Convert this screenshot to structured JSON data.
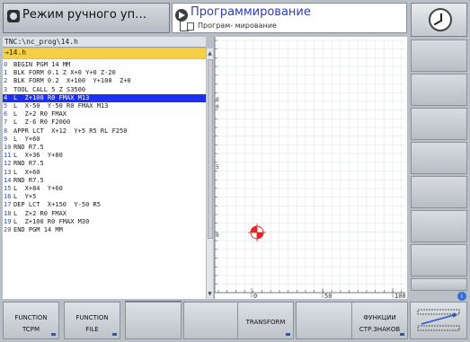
{
  "header": {
    "mode_manual_label": "Режим ручного уп…",
    "mode_program_label": "Программирование",
    "mode_program_sub": "Програм- мирование"
  },
  "editor": {
    "path": "TNC:\\nc_prog\\14.h",
    "file": "→14.h",
    "lines": [
      {
        "num": "0",
        "code": "BEGIN PGM 14 MM"
      },
      {
        "num": "1",
        "code": "BLK FORM 0.1 Z X+0 Y+0 Z-20"
      },
      {
        "num": "2",
        "code": "BLK FORM 0.2  X+100  Y+100  Z+0"
      },
      {
        "num": "3",
        "code": "TOOL CALL 5 Z S3500"
      },
      {
        "num": "4",
        "code": "L  Z+100 R0 FMAX M13",
        "selected": true
      },
      {
        "num": "5",
        "code": "L  X-50  Y-50 R0 FMAX M13"
      },
      {
        "num": "6",
        "code": "L  Z+2 R0 FMAX"
      },
      {
        "num": "7",
        "code": "L  Z-6 R0 F2000"
      },
      {
        "num": "8",
        "code": "APPR LCT  X+12  Y+5 R5 RL F250"
      },
      {
        "num": "9",
        "code": "L  Y+60"
      },
      {
        "num": "10",
        "code": "RND R7.5"
      },
      {
        "num": "11",
        "code": "L  X+36  Y+80"
      },
      {
        "num": "12",
        "code": "RND R7.5"
      },
      {
        "num": "13",
        "code": "L  X+60"
      },
      {
        "num": "14",
        "code": "RND R7.5"
      },
      {
        "num": "15",
        "code": "L  X+84  Y+60"
      },
      {
        "num": "16",
        "code": "L  Y+5"
      },
      {
        "num": "17",
        "code": "DEP LCT  X+150  Y-50 R5"
      },
      {
        "num": "18",
        "code": "L  Z+2 R0 FMAX"
      },
      {
        "num": "19",
        "code": "L  Z+100 R0 FMAX M30"
      },
      {
        "num": "20",
        "code": "END PGM 14 MM"
      }
    ]
  },
  "graphics": {
    "x_ticks": [
      "0",
      "50",
      "100"
    ],
    "y_ticks": [
      "0",
      "0",
      "5",
      "0"
    ]
  },
  "softkeys": {
    "fn_tcpm_l1": "FUNCTION",
    "fn_tcpm_l2": "TCPM",
    "fn_file_l1": "FUNCTION",
    "fn_file_l2": "FILE",
    "transform": "TRANSFORM",
    "special_l1": "ФУНКЦИИ",
    "special_l2": "СТР.ЗНАКОВ"
  },
  "colors": {
    "selection": "#1d2ff0",
    "file_bar": "#f5cf45",
    "program_title": "#2c3db0",
    "datum_marker": "#e0282a"
  }
}
